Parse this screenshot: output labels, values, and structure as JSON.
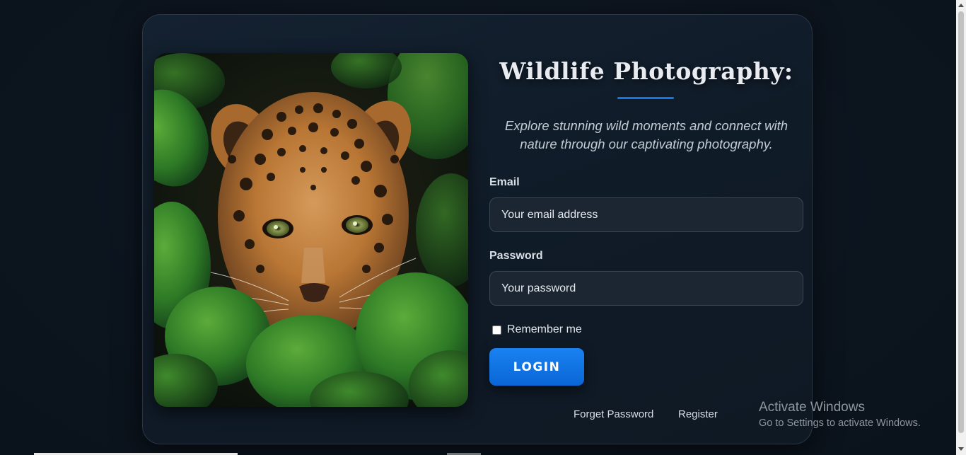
{
  "card": {
    "title": "Wildlife Photography:",
    "subtitle": "Explore stunning wild moments and connect with nature through our captivating photography.",
    "photo_icon": "leopard-photo",
    "accent_color": "#1476e6"
  },
  "form": {
    "email_label": "Email",
    "email_placeholder": "Your email address",
    "password_label": "Password",
    "password_placeholder": "Your password",
    "remember_label": "Remember me",
    "remember_checked": false,
    "login_label": "LOGIN"
  },
  "footer": {
    "forget_password": "Forget Password",
    "register": "Register"
  },
  "watermark": {
    "title": "Activate Windows",
    "subtitle": "Go to Settings to activate Windows."
  }
}
